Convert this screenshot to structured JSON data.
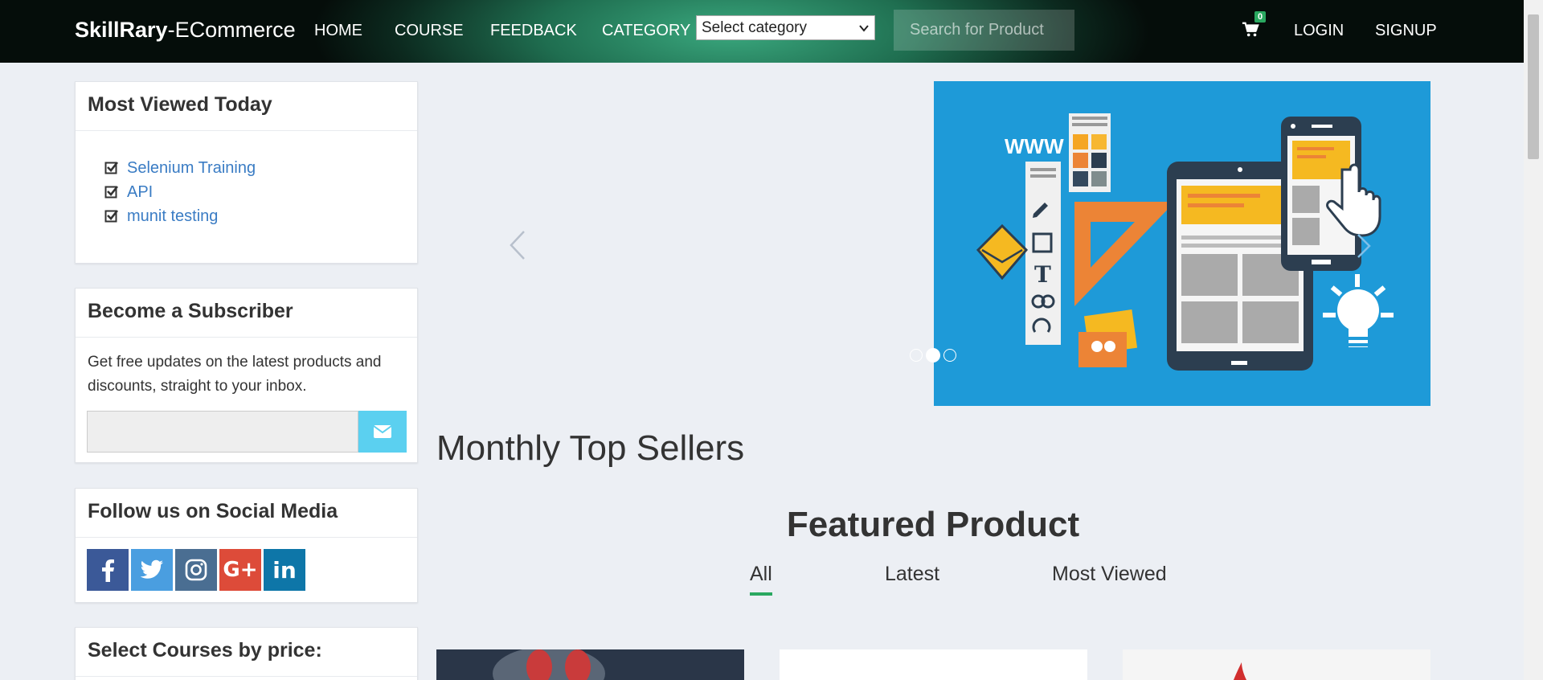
{
  "nav": {
    "brand_bold": "SkillRary",
    "brand_rest": "-ECommerce",
    "links": [
      "HOME",
      "COURSE",
      "FEEDBACK",
      "CATEGORY"
    ],
    "category_select": "Select category",
    "search_placeholder": "Search for Product",
    "cart_count": "0",
    "login": "LOGIN",
    "signup": "SIGNUP",
    "colors": {
      "gradient_center": "#3aa87e",
      "badge": "#2aa860"
    }
  },
  "sidebar": {
    "most_viewed": {
      "title": "Most Viewed Today",
      "items": [
        "Selenium Training",
        "API",
        "munit testing"
      ]
    },
    "subscriber": {
      "title": "Become a Subscriber",
      "text": "Get free updates on the latest products and discounts, straight to your inbox.",
      "button_icon": "envelope-icon"
    },
    "social": {
      "title": "Follow us on Social Media",
      "icons": [
        {
          "name": "facebook-icon",
          "glyph": "f",
          "color": "#3b5998"
        },
        {
          "name": "twitter-icon",
          "glyph": "t",
          "color": "#4a9ee0"
        },
        {
          "name": "instagram-icon",
          "glyph": "ig",
          "color": "#4a6e92"
        },
        {
          "name": "google-plus-icon",
          "glyph": "G+",
          "color": "#dd4b39"
        },
        {
          "name": "linkedin-icon",
          "glyph": "in",
          "color": "#0e76a8"
        }
      ]
    },
    "price": {
      "title": "Select Courses by price:"
    }
  },
  "carousel": {
    "www_text": "WWW",
    "dots": 3,
    "active_dot": 2,
    "bg_color": "#1e9ad8"
  },
  "main": {
    "monthly_heading": "Monthly Top Sellers",
    "featured_heading": "Featured Product",
    "tabs": [
      "All",
      "Latest",
      "Most Viewed"
    ],
    "active_tab": "All"
  }
}
